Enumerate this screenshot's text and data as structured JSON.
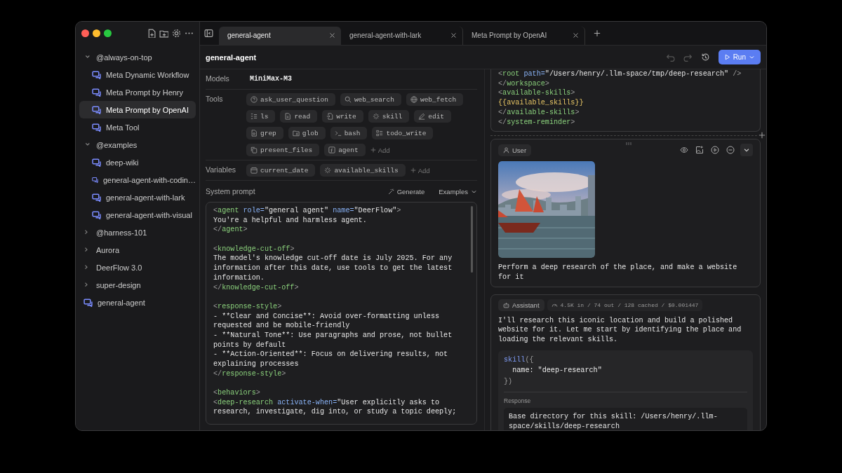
{
  "sidebar": {
    "groups": [
      {
        "kind": "group",
        "label": "@always-on-top",
        "expanded": true,
        "children": [
          {
            "label": "Meta Dynamic Workflow",
            "selected": false
          },
          {
            "label": "Meta Prompt by Henry",
            "selected": false
          },
          {
            "label": "Meta Prompt by OpenAI",
            "selected": true
          },
          {
            "label": "Meta Tool",
            "selected": false
          }
        ]
      },
      {
        "kind": "group",
        "label": "@examples",
        "expanded": true,
        "children": [
          {
            "label": "deep-wiki",
            "selected": false
          },
          {
            "label": "general-agent-with-codin…",
            "selected": false
          },
          {
            "label": "general-agent-with-lark",
            "selected": false
          },
          {
            "label": "general-agent-with-visual",
            "selected": false
          }
        ]
      },
      {
        "kind": "group",
        "label": "@harness-101",
        "expanded": false
      },
      {
        "kind": "group",
        "label": "Aurora",
        "expanded": false
      },
      {
        "kind": "group",
        "label": "DeerFlow 3.0",
        "expanded": false
      },
      {
        "kind": "group",
        "label": "super-design",
        "expanded": false
      },
      {
        "kind": "item",
        "label": "general-agent",
        "selected": false
      }
    ]
  },
  "tabs": [
    {
      "label": "general-agent",
      "selected": true
    },
    {
      "label": "general-agent-with-lark",
      "selected": false
    },
    {
      "label": "Meta Prompt by OpenAI",
      "selected": false
    }
  ],
  "header": {
    "title": "general-agent",
    "run_button": "Run"
  },
  "config": {
    "models_label": "Models",
    "model": "MiniMax-M3",
    "tools_label": "Tools",
    "tools": [
      [
        "ask_user_question",
        "web_search",
        "web_fetch"
      ],
      [
        "ls",
        "read",
        "write",
        "skill",
        "edit"
      ],
      [
        "grep",
        "glob",
        "bash",
        "todo_write"
      ],
      [
        "present_files",
        "agent"
      ]
    ],
    "tools_add": "Add",
    "variables_label": "Variables",
    "variables": [
      "current_date",
      "available_skills"
    ],
    "variables_add": "Add"
  },
  "system_prompt": {
    "label": "System prompt",
    "generate": "Generate",
    "examples": "Examples",
    "blocks": [
      [
        [
          {
            "kind": "p",
            "t": "<"
          },
          {
            "kind": "tag",
            "t": "agent"
          },
          {
            "kind": "attr",
            "t": " role="
          },
          {
            "kind": "str",
            "t": "\"general agent\""
          },
          {
            "kind": "attr",
            "t": " name="
          },
          {
            "kind": "str",
            "t": "\"DeerFlow\""
          },
          {
            "kind": "p",
            "t": ">"
          }
        ],
        [
          {
            "kind": "txt",
            "t": "You're a helpful and harmless agent."
          }
        ],
        [
          {
            "kind": "p",
            "t": "</"
          },
          {
            "kind": "tag",
            "t": "agent"
          },
          {
            "kind": "p",
            "t": ">"
          }
        ]
      ],
      [
        [
          {
            "kind": "p",
            "t": "<"
          },
          {
            "kind": "tag",
            "t": "knowledge-cut-off"
          },
          {
            "kind": "p",
            "t": ">"
          }
        ],
        [
          {
            "kind": "txt",
            "t": "The model's knowledge cut-off date is July 2025. For any"
          }
        ],
        [
          {
            "kind": "txt",
            "t": "information after this date, use tools to get the latest"
          }
        ],
        [
          {
            "kind": "txt",
            "t": "information."
          }
        ],
        [
          {
            "kind": "p",
            "t": "</"
          },
          {
            "kind": "tag",
            "t": "knowledge-cut-off"
          },
          {
            "kind": "p",
            "t": ">"
          }
        ]
      ],
      [
        [
          {
            "kind": "p",
            "t": "<"
          },
          {
            "kind": "tag",
            "t": "response-style"
          },
          {
            "kind": "p",
            "t": ">"
          }
        ],
        [
          {
            "kind": "txt",
            "t": "- **Clear and Concise**: Avoid over-formatting unless"
          }
        ],
        [
          {
            "kind": "txt",
            "t": "requested and be mobile-friendly"
          }
        ],
        [
          {
            "kind": "txt",
            "t": "- **Natural Tone**: Use paragraphs and prose, not bullet"
          }
        ],
        [
          {
            "kind": "txt",
            "t": "points by default"
          }
        ],
        [
          {
            "kind": "txt",
            "t": "- **Action-Oriented**: Focus on delivering results, not"
          }
        ],
        [
          {
            "kind": "txt",
            "t": "explaining processes"
          }
        ],
        [
          {
            "kind": "p",
            "t": "</"
          },
          {
            "kind": "tag",
            "t": "response-style"
          },
          {
            "kind": "p",
            "t": ">"
          }
        ]
      ],
      [
        [
          {
            "kind": "p",
            "t": "<"
          },
          {
            "kind": "tag",
            "t": "behaviors"
          },
          {
            "kind": "p",
            "t": ">"
          }
        ],
        [
          {
            "kind": "p",
            "t": "<"
          },
          {
            "kind": "tag",
            "t": "deep-research"
          },
          {
            "kind": "attr",
            "t": " activate-when="
          },
          {
            "kind": "str",
            "t": "\"User explicitly asks to"
          }
        ],
        [
          {
            "kind": "str",
            "t": "research, investigate, dig into, or study a topic deeply;"
          }
        ]
      ]
    ]
  },
  "messages": [
    {
      "kind": "system",
      "lines": [
        [
          {
            "kind": "p",
            "t": "<"
          },
          {
            "kind": "tag",
            "t": "root"
          },
          {
            "kind": "attr",
            "t": " path="
          },
          {
            "kind": "str",
            "t": "\"/Users/henry/.llm-space/tmp/deep-research\""
          },
          {
            "kind": "p",
            "t": " />"
          }
        ],
        [
          {
            "kind": "p",
            "t": "</"
          },
          {
            "kind": "tag",
            "t": "workspace"
          },
          {
            "kind": "p",
            "t": ">"
          }
        ],
        [
          {
            "kind": "p",
            "t": "<"
          },
          {
            "kind": "tag",
            "t": "available-skills"
          },
          {
            "kind": "p",
            "t": ">"
          }
        ],
        [
          {
            "kind": "var",
            "t": "{{available_skills}}"
          }
        ],
        [
          {
            "kind": "p",
            "t": "</"
          },
          {
            "kind": "tag",
            "t": "available-skills"
          },
          {
            "kind": "p",
            "t": ">"
          }
        ],
        [
          {
            "kind": "p",
            "t": "</"
          },
          {
            "kind": "tag",
            "t": "system-reminder"
          },
          {
            "kind": "p",
            "t": ">"
          }
        ]
      ]
    },
    {
      "kind": "user",
      "role": "User",
      "text": "Perform a deep research of the place, and make a website\nfor it"
    },
    {
      "kind": "assistant",
      "role": "Assistant",
      "usage": "4.5K in / 74 out / 128 cached / $0.001447",
      "text": "I'll research this iconic location and build a polished\nwebsite for it. Let me start by identifying the place and\nloading the relevant skills.",
      "tool_call": {
        "lines": [
          [
            {
              "kind": "fn",
              "t": "skill"
            },
            {
              "kind": "p",
              "t": "({"
            }
          ],
          [
            {
              "kind": "key",
              "t": "  name: "
            },
            {
              "kind": "key",
              "t": "\"deep-research\""
            }
          ],
          [
            {
              "kind": "p",
              "t": "})"
            }
          ]
        ],
        "response_label": "Response",
        "response": "Base directory for this skill: /Users/henry/.llm-\nspace/skills/deep-research"
      }
    }
  ]
}
